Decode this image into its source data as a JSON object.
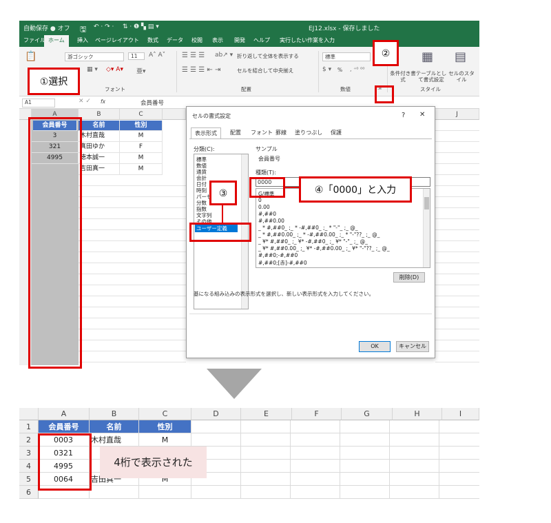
{
  "window": {
    "quick_access": "自動保存 ● オフ",
    "title": "EJ12.xlsx - 保存しました"
  },
  "ribbon_tabs": [
    "ファイル",
    "ホーム",
    "挿入",
    "ページレイアウト",
    "数式",
    "データ",
    "校閲",
    "表示",
    "開発",
    "ヘルプ",
    "実行したい作業を入力"
  ],
  "ribbon": {
    "font_name": "游ゴシック",
    "font_size": "11",
    "wrap_text": "折り返して全体を表示する",
    "merge_center": "セルを結合して中央揃え",
    "number_format": "標準",
    "percent": "%",
    "conditional_format": "条件付き書式",
    "format_as_table": "テーブルとして書式設定",
    "cell_styles": "セルのスタイル",
    "group_font": "フォント",
    "group_align": "配置",
    "group_number": "数値",
    "group_style": "スタイル"
  },
  "formula_bar": {
    "name_box": "A1",
    "fx": "fx",
    "content": "会員番号"
  },
  "grid_top": {
    "columns": [
      "A",
      "B",
      "C"
    ],
    "extra_columns": [
      "J"
    ],
    "rows": [
      [
        "会員番号",
        "名前",
        "性別"
      ],
      [
        "3",
        "木村直哉",
        "M"
      ],
      [
        "321",
        "真田ゆか",
        "F"
      ],
      [
        "4995",
        "徳本誠一",
        "M"
      ],
      [
        "",
        "吉田真一",
        "M"
      ]
    ]
  },
  "dialog": {
    "title": "セルの書式設定",
    "help": "?",
    "close": "✕",
    "tabs": [
      "表示形式",
      "配置",
      "フォント",
      "罫線",
      "塗りつぶし",
      "保護"
    ],
    "category_label": "分類(C):",
    "categories": [
      "標準",
      "数値",
      "通貨",
      "会計",
      "日付",
      "時刻",
      "パーセンテージ",
      "分数",
      "指数",
      "文字列",
      "その他",
      "ユーザー定義"
    ],
    "sample_label": "サンプル",
    "sample_value": "会員番号",
    "type_label": "種類(T):",
    "type_value": "0000",
    "formats": [
      "G/標準",
      "0",
      "0.00",
      "#,##0",
      "#,##0.00",
      "_ * #,##0_ ;_ * -#,##0_ ;_ * \"-\"_ ;_ @_",
      "_ * #,##0.00_ ;_ * -#,##0.00_ ;_ * \"-\"??_ ;_ @_",
      "_ ¥* #,##0_ ;_ ¥* -#,##0_ ;_ ¥* \"-\"_ ;_ @_",
      "_ ¥* #,##0.00_ ;_ ¥* -#,##0.00_ ;_ ¥* \"-\"??_ ;_ @_",
      "#,##0;-#,##0",
      "#,##0;[赤]-#,##0"
    ],
    "delete_button": "削除(D)",
    "description": "基になる組み込みの表示形式を選択し、新しい表示形式を入力してください。",
    "ok": "OK",
    "cancel": "キャンセル"
  },
  "callouts": {
    "step1": "①選択",
    "step2": "②",
    "step3": "③",
    "step4": "④「0000」と入力",
    "result": "4桁で表示された"
  },
  "grid_bottom": {
    "columns": [
      "A",
      "B",
      "C",
      "D",
      "E",
      "F",
      "G",
      "H",
      "I"
    ],
    "row_numbers": [
      "1",
      "2",
      "3",
      "4",
      "5",
      "6"
    ],
    "rows": [
      [
        "会員番号",
        "名前",
        "性別"
      ],
      [
        "0003",
        "木村直哉",
        "M"
      ],
      [
        "0321",
        "",
        ""
      ],
      [
        "4995",
        "",
        ""
      ],
      [
        "0064",
        "吉田真一",
        "M"
      ],
      [
        "",
        "",
        ""
      ]
    ]
  },
  "colors": {
    "excel_green": "#217346",
    "header_blue": "#4472c4",
    "callout_red": "#e00000",
    "selection_gray": "#bfbfbf",
    "note_bg": "#f7e3e3"
  }
}
